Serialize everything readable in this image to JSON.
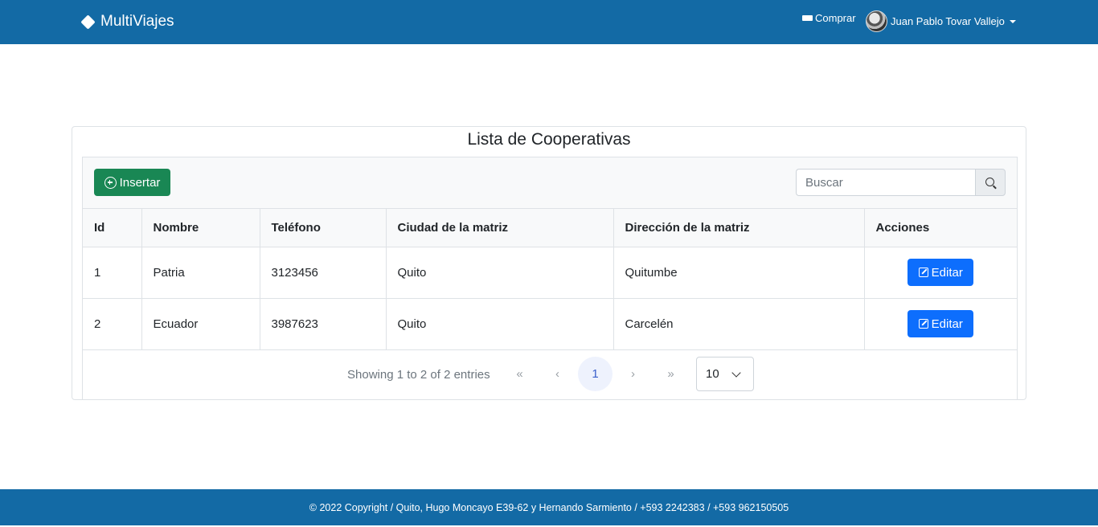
{
  "navbar": {
    "brand": "MultiViajes",
    "buy_label": "Comprar",
    "user_name": "Juan Pablo Tovar Vallejo"
  },
  "card": {
    "title": "Lista de Cooperativas",
    "insert_label": "Insertar",
    "search_placeholder": "Buscar"
  },
  "table": {
    "headers": [
      "Id",
      "Nombre",
      "Teléfono",
      "Ciudad de la matriz",
      "Dirección de la matriz",
      "Acciones"
    ],
    "rows": [
      {
        "id": "1",
        "nombre": "Patria",
        "telefono": "3123456",
        "ciudad": "Quito",
        "direccion": "Quitumbe",
        "action": "Editar"
      },
      {
        "id": "2",
        "nombre": "Ecuador",
        "telefono": "3987623",
        "ciudad": "Quito",
        "direccion": "Carcelén",
        "action": "Editar"
      }
    ]
  },
  "pagination": {
    "info": "Showing 1 to 2 of 2 entries",
    "first": "«",
    "prev": "‹",
    "current_page": "1",
    "next": "›",
    "last": "»",
    "page_size": "10"
  },
  "footer": {
    "text": "© 2022 Copyright / Quito, Hugo Moncayo E39-62 y Hernando Sarmiento / +593 2242383 / +593 962150505"
  },
  "colors": {
    "navbar": "#136aa5",
    "insert_button": "#198754",
    "edit_button": "#0d6efd"
  }
}
